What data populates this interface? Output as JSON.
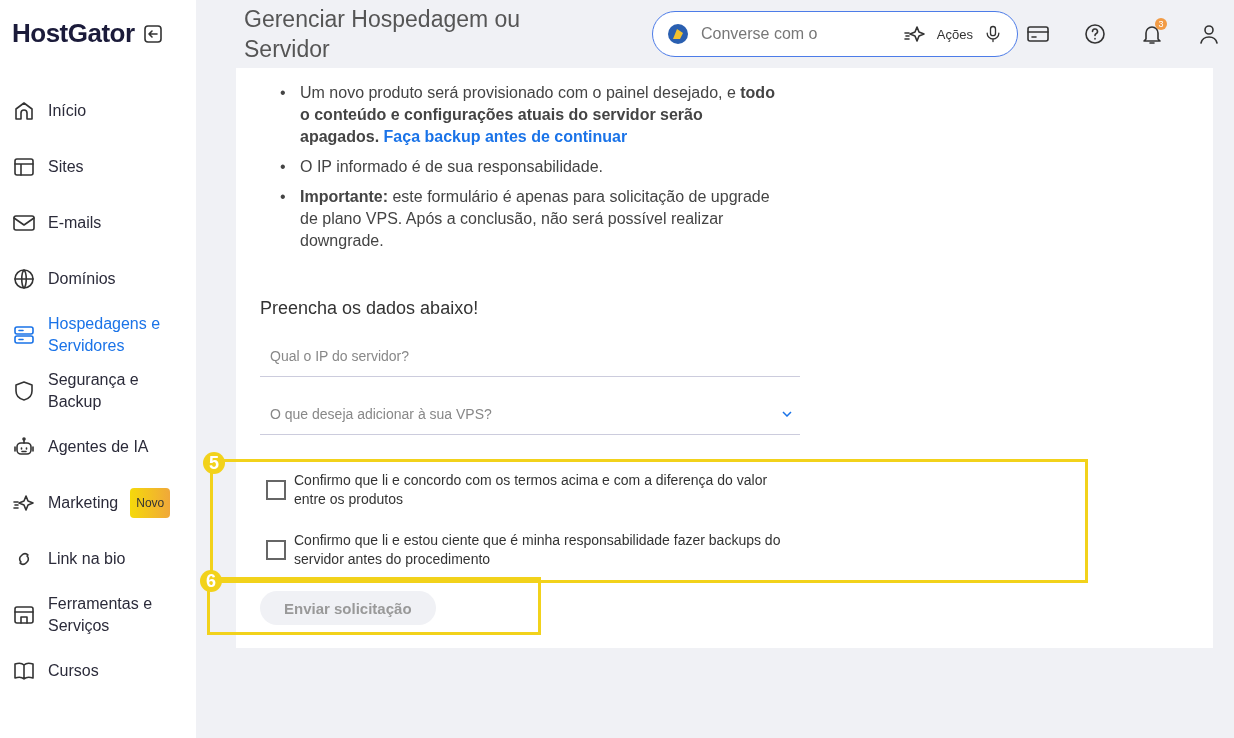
{
  "sidebar": {
    "logo": "HostGator",
    "items": [
      {
        "label": "Início",
        "selected": false
      },
      {
        "label": "Sites",
        "selected": false
      },
      {
        "label": "E-mails",
        "selected": false
      },
      {
        "label": "Domínios",
        "selected": false
      },
      {
        "label": "Hospedagens e Servidores",
        "selected": true
      },
      {
        "label": "Segurança e Backup",
        "selected": false
      },
      {
        "label": "Agentes de IA",
        "selected": false
      },
      {
        "label": "Marketing",
        "selected": false,
        "badge": "Novo"
      },
      {
        "label": "Link na bio",
        "selected": false
      },
      {
        "label": "Ferramentas e Serviços",
        "selected": false
      },
      {
        "label": "Cursos",
        "selected": false
      }
    ]
  },
  "header": {
    "title": "Gerenciar Hospedagem ou Servidor",
    "chat": {
      "placeholder": "Converse com o",
      "action": "Ações"
    },
    "notifications": "3"
  },
  "content": {
    "bullets": [
      {
        "marker": "•",
        "text": "Um novo produto será provisionado com o painel desejado, e **todo o conteúdo e configurações atuais do servidor serão apagados.**",
        "link": "Faça backup antes de continuar"
      },
      {
        "marker": "•",
        "text": "O IP informado é de sua responsabilidade."
      },
      {
        "marker": "•",
        "text": "**Importante:** este formulário é apenas para solicitação de upgrade de plano VPS. Após a conclusão, não será possível realizar downgrade."
      }
    ],
    "form_title": "Preencha os dados abaixo!",
    "fields": [
      {
        "kind": "text",
        "placeholder": "Qual o IP do servidor?"
      },
      {
        "kind": "select",
        "placeholder": "O que deseja adicionar à sua VPS?"
      }
    ],
    "checkboxes": [
      {
        "label": "Confirmo que li e concordo com os termos acima e com a diferença do valor entre os produtos",
        "checked": false
      },
      {
        "label": "Confirmo que li e estou ciente que é minha responsabilidade fazer backups do servidor antes do procedimento",
        "checked": false
      }
    ],
    "submit": {
      "label": "Enviar solicitação",
      "disabled": true
    }
  },
  "annotations": [
    {
      "label": "5"
    },
    {
      "label": "6"
    }
  ]
}
